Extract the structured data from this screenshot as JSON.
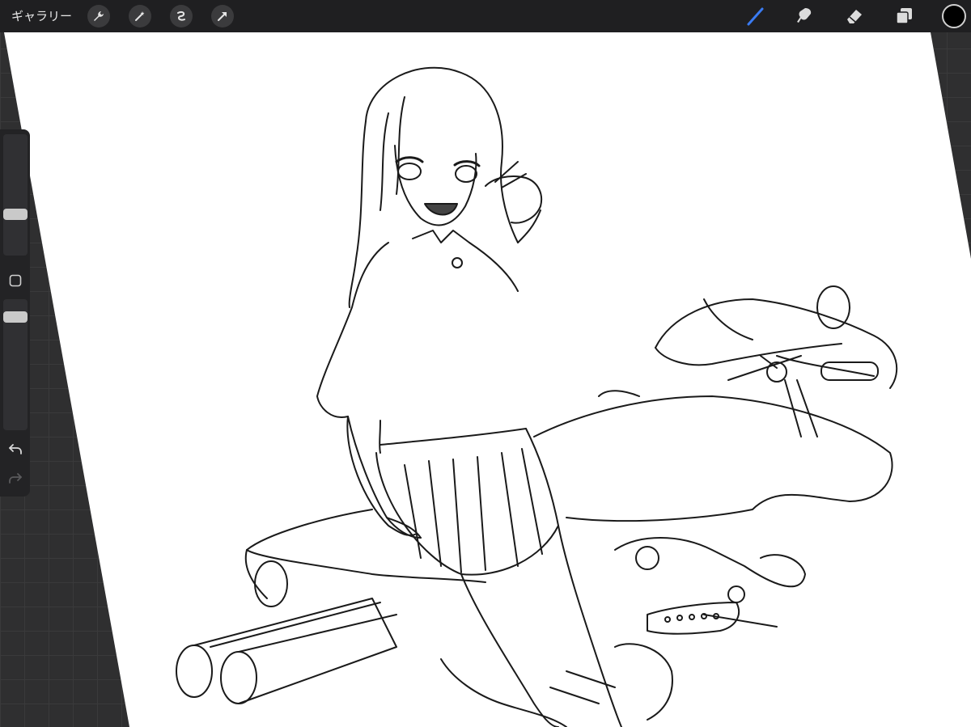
{
  "toolbar": {
    "gallery_label": "ギャラリー",
    "left_tools": [
      "wrench-icon",
      "magic-wand-icon",
      "selection-icon",
      "transform-arrow-icon"
    ],
    "right_tools": [
      "brush-icon",
      "smudge-icon",
      "eraser-icon",
      "layers-icon"
    ],
    "active_tool": "brush",
    "accent_color": "#3a7bf2",
    "current_color": "#000000"
  },
  "sidebar": {
    "brush_size": 0.5,
    "opacity": 0.7,
    "modify_button": "square-icon",
    "undo": "undo-icon",
    "redo": "redo-icon"
  },
  "canvas": {
    "description_free": true,
    "paper_color": "#ffffff",
    "line_color": "#1a1a1a"
  }
}
